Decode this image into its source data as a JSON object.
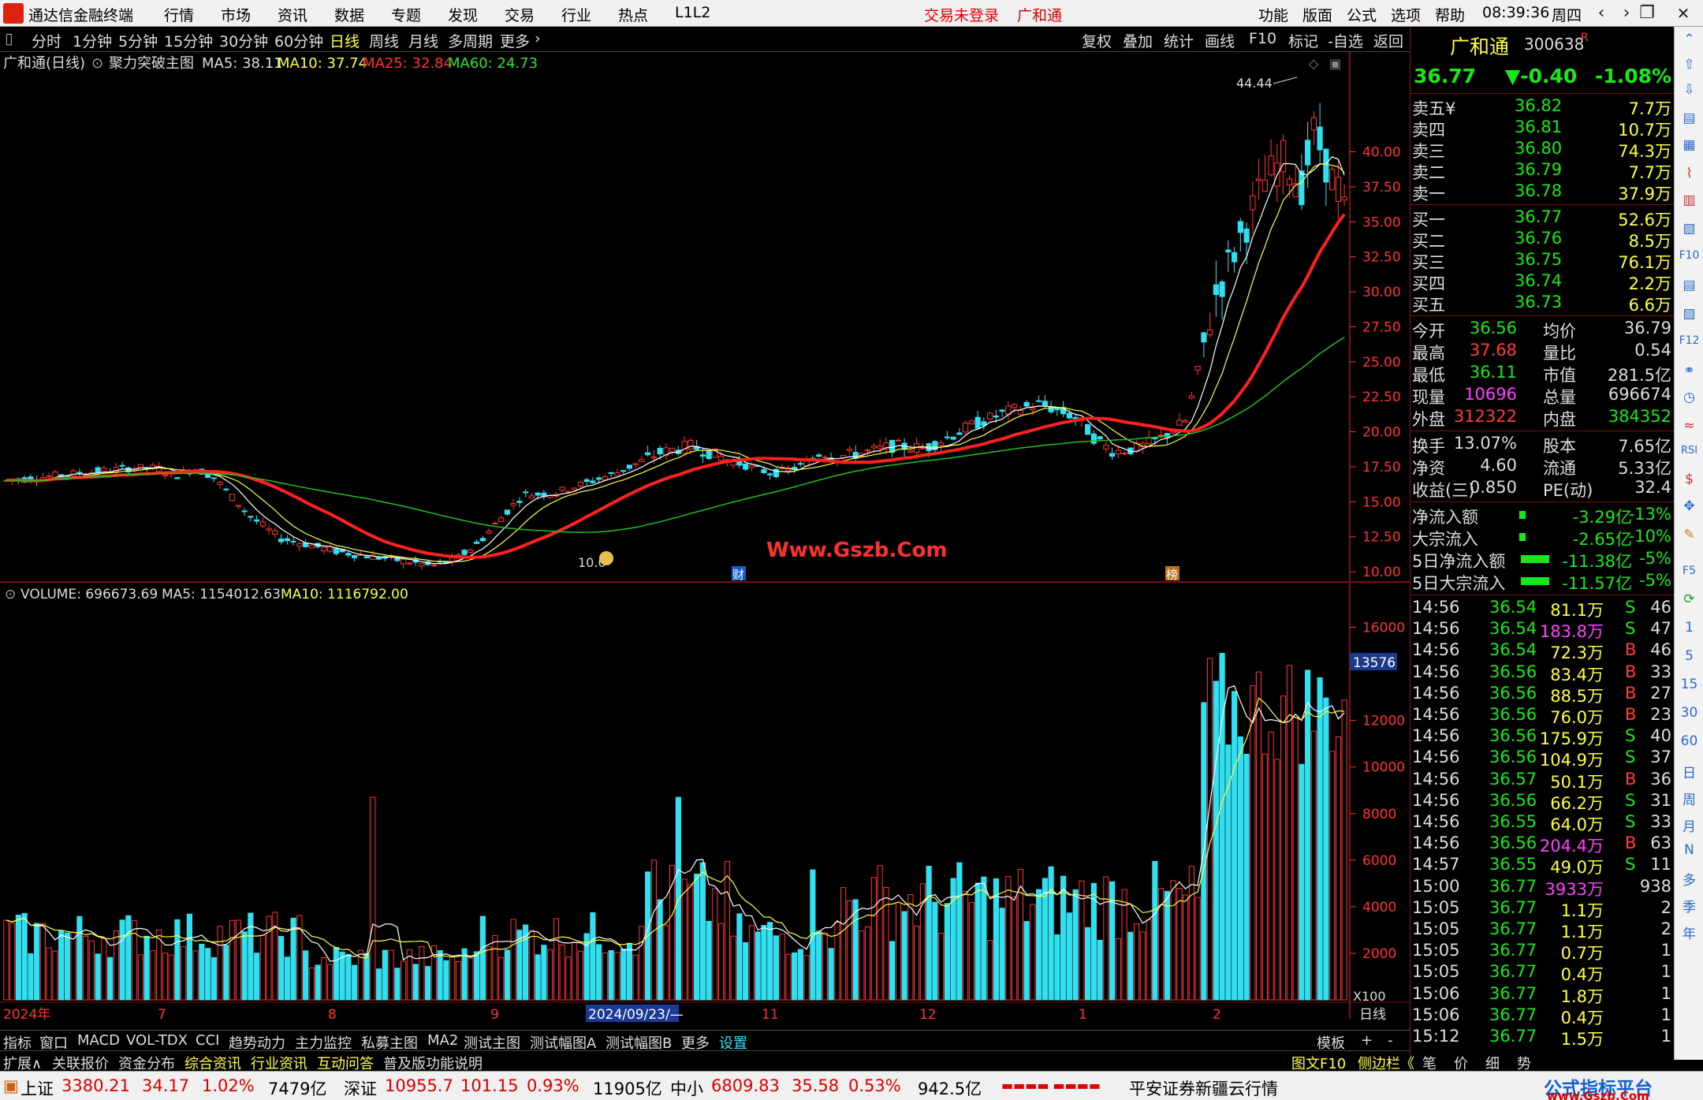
{
  "app": {
    "title": "通达信金融终端",
    "menu": [
      "行情",
      "市场",
      "资讯",
      "数据",
      "专题",
      "发现",
      "交易",
      "行业",
      "热点",
      "L1L2"
    ],
    "login_status": "交易未登录",
    "stock_tag": "广和通",
    "right_menu": [
      "功能",
      "版面",
      "公式",
      "选项",
      "帮助"
    ],
    "time": "08:39:36",
    "weekday": "周四"
  },
  "period_tabs": [
    "分时",
    "1分钟",
    "5分钟",
    "15分钟",
    "30分钟",
    "60分钟",
    "日线",
    "周线",
    "月线",
    "多周期",
    "更多"
  ],
  "period_active": "日线",
  "chart_tools": [
    "复权",
    "叠加",
    "统计",
    "画线",
    "F10",
    "标记",
    "-自选",
    "返回"
  ],
  "main_chart": {
    "title": "广和通(日线)",
    "indicator": "聚力突破主图",
    "ma5": "MA5: 38.11",
    "ma10": "MA10: 37.74",
    "ma25": "MA25: 32.84",
    "ma60": "MA60: 24.73",
    "y_ticks": [
      "40.00",
      "37.50",
      "35.00",
      "32.50",
      "30.00",
      "27.50",
      "25.00",
      "22.50",
      "20.00",
      "17.50",
      "15.00",
      "12.50",
      "10.00"
    ],
    "high_label": "44.44",
    "low_label": "10.0",
    "finance_mark": "财",
    "rank_mark": "榜",
    "watermark": "Www.Gszb.Com"
  },
  "volume_chart": {
    "title": "VOLUME: 696673.69",
    "ma5": "MA5: 1154012.63",
    "ma10": "MA10: 1116792.00",
    "y_ticks": [
      "16000",
      "12000",
      "10000",
      "8000",
      "6000",
      "4000",
      "2000"
    ],
    "cursor_value": "13576",
    "unit": "X100"
  },
  "x_axis": {
    "labels": [
      "2024年",
      "7",
      "8",
      "9",
      "2024/09/23/—",
      "11",
      "12",
      "1",
      "2"
    ],
    "period": "日线"
  },
  "chart_data": {
    "type": "candlestick",
    "title": "广和通(日线)",
    "y_range": [
      9.5,
      46
    ],
    "ma": {
      "MA5": 38.11,
      "MA10": 37.74,
      "MA25": 32.84,
      "MA60": 24.73
    },
    "high": 44.44,
    "low": 10.0,
    "volume_range": [
      0,
      17000
    ],
    "volume_last": 696673.69,
    "volume_ma5": 1154012.63,
    "volume_ma10": 1116792.0
  },
  "quote": {
    "name": "广和通",
    "code": "300638",
    "flag": "R",
    "price": "36.77",
    "change": "▼-0.40",
    "pct": "-1.08%",
    "asks": [
      [
        "卖五¥",
        "36.82",
        "7.7万"
      ],
      [
        "卖四",
        "36.81",
        "10.7万"
      ],
      [
        "卖三",
        "36.80",
        "74.3万"
      ],
      [
        "卖二",
        "36.79",
        "7.7万"
      ],
      [
        "卖一",
        "36.78",
        "37.9万"
      ]
    ],
    "bids": [
      [
        "买一",
        "36.77",
        "52.6万"
      ],
      [
        "买二",
        "36.76",
        "8.5万"
      ],
      [
        "买三",
        "36.75",
        "76.1万"
      ],
      [
        "买四",
        "36.74",
        "2.2万"
      ],
      [
        "买五",
        "36.73",
        "6.6万"
      ]
    ],
    "stats": [
      [
        "今开",
        "36.56",
        "均价",
        "36.79"
      ],
      [
        "最高",
        "37.68",
        "量比",
        "0.54"
      ],
      [
        "最低",
        "36.11",
        "市值",
        "281.5亿"
      ],
      [
        "现量",
        "10696",
        "总量",
        "696674"
      ],
      [
        "外盘",
        "312322",
        "内盘",
        "384352"
      ]
    ],
    "stats2": [
      [
        "换手",
        "13.07%",
        "股本",
        "7.65亿"
      ],
      [
        "净资",
        "4.60",
        "流通",
        "5.33亿"
      ],
      [
        "收益(三)",
        "0.850",
        "PE(动)",
        "32.4"
      ]
    ],
    "flows": [
      [
        "净流入额",
        "-3.29亿",
        "-13%"
      ],
      [
        "大宗流入",
        "-2.65亿",
        "-10%"
      ],
      [
        "5日净流入额",
        "-11.38亿",
        "-5%"
      ],
      [
        "5日大宗流入",
        "-11.57亿",
        "-5%"
      ]
    ],
    "ticks": [
      [
        "14:56",
        "36.54",
        "81.1万",
        "S",
        "46"
      ],
      [
        "14:56",
        "36.54",
        "183.8万",
        "S",
        "47"
      ],
      [
        "14:56",
        "36.54",
        "72.3万",
        "B",
        "46"
      ],
      [
        "14:56",
        "36.56",
        "83.4万",
        "B",
        "33"
      ],
      [
        "14:56",
        "36.56",
        "88.5万",
        "B",
        "27"
      ],
      [
        "14:56",
        "36.56",
        "76.0万",
        "B",
        "23"
      ],
      [
        "14:56",
        "36.56",
        "175.9万",
        "S",
        "40"
      ],
      [
        "14:56",
        "36.56",
        "104.9万",
        "S",
        "37"
      ],
      [
        "14:56",
        "36.57",
        "50.1万",
        "B",
        "36"
      ],
      [
        "14:56",
        "36.56",
        "66.2万",
        "S",
        "31"
      ],
      [
        "14:56",
        "36.55",
        "64.0万",
        "S",
        "33"
      ],
      [
        "14:56",
        "36.56",
        "204.4万",
        "B",
        "63"
      ],
      [
        "14:57",
        "36.55",
        "49.0万",
        "S",
        "11"
      ],
      [
        "15:00",
        "36.77",
        "3933万",
        "",
        "938"
      ],
      [
        "15:05",
        "36.77",
        "1.1万",
        "",
        "2"
      ],
      [
        "15:05",
        "36.77",
        "1.1万",
        "",
        "2"
      ],
      [
        "15:05",
        "36.77",
        "0.7万",
        "",
        "1"
      ],
      [
        "15:05",
        "36.77",
        "0.4万",
        "",
        "1"
      ],
      [
        "15:06",
        "36.77",
        "1.8万",
        "",
        "1"
      ],
      [
        "15:06",
        "36.77",
        "0.4万",
        "",
        "1"
      ],
      [
        "15:12",
        "36.77",
        "1.5万",
        "",
        "1"
      ]
    ]
  },
  "bottom_tabs1": [
    "指标",
    "窗口",
    "MACD",
    "VOL-TDX",
    "CCI",
    "趋势动力",
    "主力监控",
    "私募主图",
    "MA2",
    "测试主图",
    "测试幅图A",
    "测试幅图B",
    "更多",
    "设置"
  ],
  "bottom_tabs1_right": [
    "模板",
    "+",
    "-"
  ],
  "bottom_tabs2": [
    "扩展∧",
    "关联报价",
    "资金分布",
    "综合资讯",
    "行业资讯",
    "互动问答",
    "普及版功能说明"
  ],
  "bottom_tabs2_right": [
    "图文F10",
    "侧边栏《",
    "笔",
    "价",
    "细",
    "势"
  ],
  "status": {
    "sh_name": "上证",
    "sh_val": "3380.21",
    "sh_chg": "34.17",
    "sh_pct": "1.02%",
    "sh_amt": "7479亿",
    "sz_name": "深证",
    "sz_val": "10955.7",
    "sz_chg": "101.15",
    "sz_pct": "0.93%",
    "sz_amt": "11905亿",
    "zx_name": "中小",
    "zx_val": "6809.83",
    "zx_chg": "35.58",
    "zx_pct": "0.53%",
    "zx_amt": "942.5亿",
    "server": "平安证券新疆云行情",
    "brand_cn": "公式指标平台",
    "brand_url": "www.Gszb.Com"
  },
  "toolstrip": [
    "日",
    "周",
    "月",
    "N",
    "多",
    "季",
    "年"
  ],
  "toolstrip_nums": [
    "1",
    "5",
    "15",
    "30",
    "60"
  ]
}
